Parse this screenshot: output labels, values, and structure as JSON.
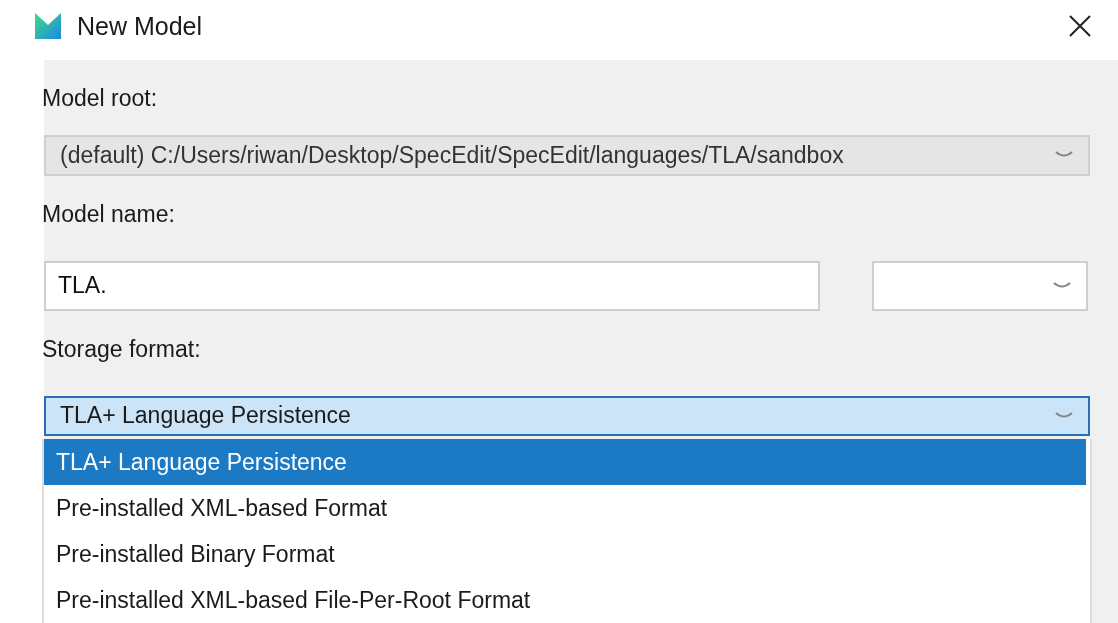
{
  "window": {
    "title": "New Model"
  },
  "model_root": {
    "label": "Model root:",
    "value": "(default) C:/Users/riwan/Desktop/SpecEdit/SpecEdit/languages/TLA/sandbox",
    "disabled": true
  },
  "model_name": {
    "label": "Model name:",
    "value": "TLA."
  },
  "storage_format": {
    "label": "Storage format:",
    "value": "TLA+ Language Persistence",
    "expanded": true,
    "options": [
      {
        "label": "TLA+ Language Persistence",
        "selected": true
      },
      {
        "label": "Pre-installed XML-based Format",
        "selected": false
      },
      {
        "label": "Pre-installed Binary Format",
        "selected": false
      },
      {
        "label": "Pre-installed XML-based File-Per-Root Format",
        "selected": false
      }
    ]
  }
}
